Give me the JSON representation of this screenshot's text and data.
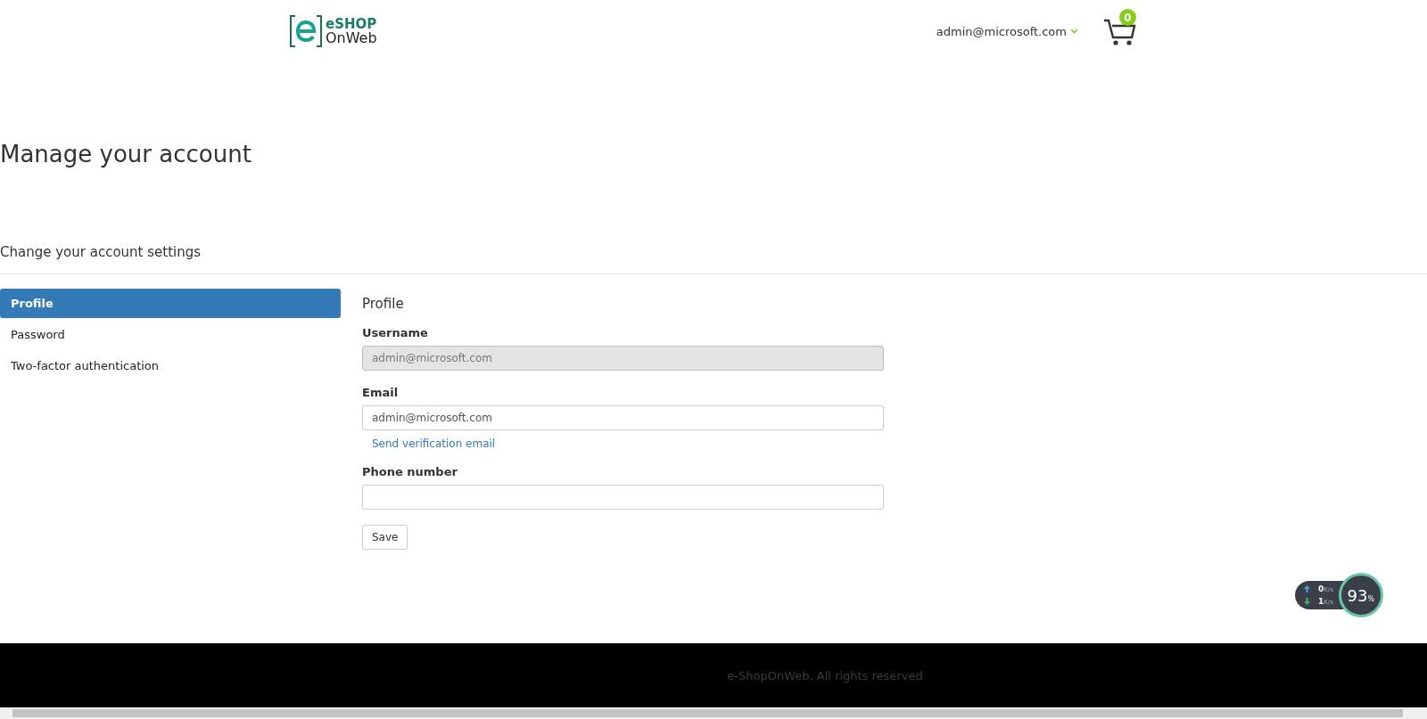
{
  "header": {
    "logo": {
      "line_1": "eSHOP",
      "line_2": "OnWeb"
    },
    "user_menu": "admin@microsoft.com",
    "cart": {
      "count": "0"
    }
  },
  "page_title": "Manage your account",
  "subtitle": "Change your account settings",
  "nav": [
    {
      "label": "Profile",
      "selected": true
    },
    {
      "label": "Password",
      "selected": false
    },
    {
      "label": "Two-factor authentication",
      "selected": false
    }
  ],
  "form": {
    "title": "Profile",
    "fields": [
      {
        "label": "Username",
        "value": "admin@microsoft.com",
        "disabled": true
      },
      {
        "label": "Email",
        "value": "admin@microsoft.com",
        "disabled": false,
        "link": "Send verification email"
      },
      {
        "label": "Phone number",
        "disabled": false
      }
    ],
    "button": "Save"
  },
  "speed_widget": {
    "upload": "0",
    "upload_unit": "K/s",
    "download": "1",
    "download_unit": "K/s",
    "percent": "93",
    "percent_unit": "%"
  },
  "footer": "e-ShopOnWeb. All rights reserved"
}
